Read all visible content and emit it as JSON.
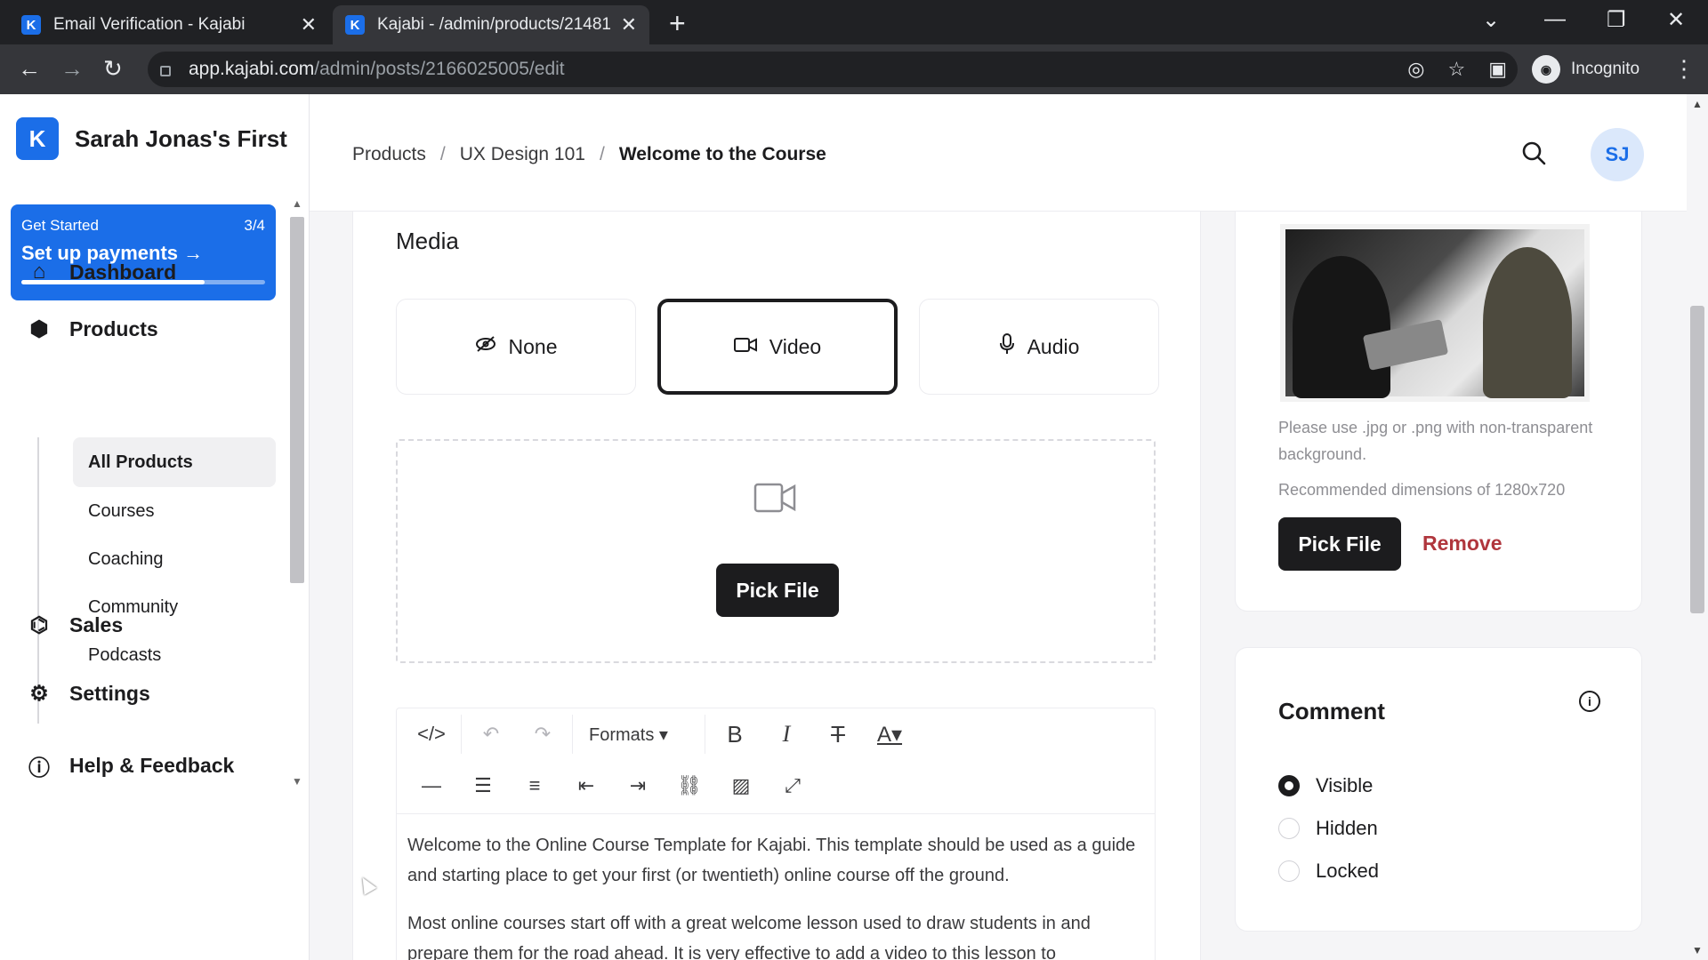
{
  "browser": {
    "tabs": [
      {
        "title": "Email Verification - Kajabi",
        "favicon": "kajabi-icon"
      },
      {
        "title": "Kajabi - /admin/products/21481",
        "favicon": "kajabi-icon"
      }
    ],
    "url_host": "app.kajabi.com",
    "url_path": "/admin/posts/2166025005/edit",
    "profile_label": "Incognito"
  },
  "sidebar": {
    "brand": "Sarah Jonas's First",
    "brand_logo": "K",
    "get_started": {
      "label": "Get Started",
      "count": "3/4",
      "title": "Set up payments",
      "progress": 0.75
    },
    "nav": {
      "dashboard": "Dashboard",
      "products": "Products",
      "sales": "Sales",
      "settings": "Settings",
      "help": "Help & Feedback"
    },
    "subitems": [
      "All Products",
      "Courses",
      "Coaching",
      "Community",
      "Podcasts"
    ]
  },
  "header": {
    "breadcrumbs": [
      "Products",
      "UX Design 101",
      "Welcome to the Course"
    ],
    "avatar": "SJ"
  },
  "media": {
    "title": "Media",
    "options": {
      "none": "None",
      "video": "Video",
      "audio": "Audio"
    },
    "selected": "Video",
    "pick_file": "Pick File"
  },
  "editor": {
    "formats": "Formats",
    "paragraphs": [
      "Welcome to the Online Course Template for Kajabi. This template should be used as a guide and starting place to get your first (or twentieth) online course off the ground.",
      "Most online courses start off with a great welcome lesson used to draw students in and prepare them for the road ahead. It is very effective to add a video to this lesson to"
    ]
  },
  "thumbnail": {
    "hint": "Please use .jpg or .png with non-transparent background.",
    "dimensions": "Recommended dimensions of 1280x720",
    "pick_file": "Pick File",
    "remove": "Remove"
  },
  "comment": {
    "title": "Comment",
    "options": [
      "Visible",
      "Hidden",
      "Locked"
    ],
    "selected": "Visible"
  },
  "colors": {
    "accent": "#1b6ee8",
    "dark": "#1c1c1e",
    "danger": "#b0363d"
  }
}
